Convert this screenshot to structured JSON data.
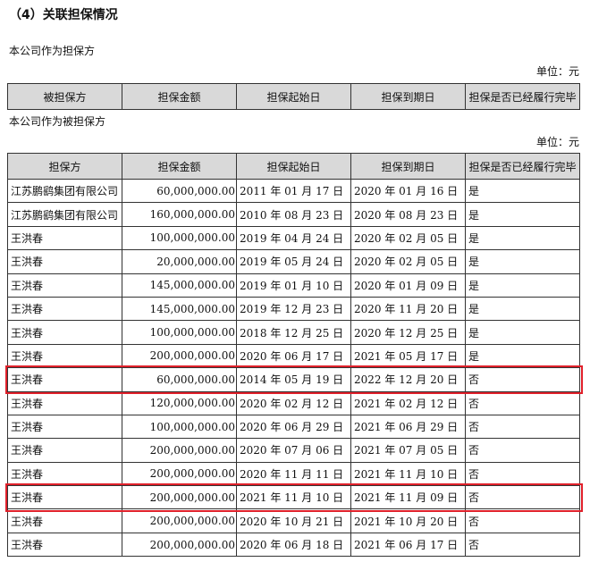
{
  "heading": "（4）关联担保情况",
  "section1": {
    "title": "本公司作为担保方",
    "unit": "单位：元",
    "headers": [
      "被担保方",
      "担保金额",
      "担保起始日",
      "担保到期日",
      "担保是否已经履行完毕"
    ]
  },
  "section2": {
    "title": "本公司作为被担保方",
    "unit": "单位：元",
    "headers": [
      "担保方",
      "担保金额",
      "担保起始日",
      "担保到期日",
      "担保是否已经履行完毕"
    ],
    "rows": [
      [
        "江苏鹏鹞集团有限公司",
        "60,000,000.00",
        "2011 年 01 月 17 日",
        "2020 年 01 月 16 日",
        "是"
      ],
      [
        "江苏鹏鹞集团有限公司",
        "160,000,000.00",
        "2010 年 08 月 23 日",
        "2020 年 08 月 23 日",
        "是"
      ],
      [
        "王洪春",
        "100,000,000.00",
        "2019 年 04 月 24 日",
        "2020 年 02 月 05 日",
        "是"
      ],
      [
        "王洪春",
        "20,000,000.00",
        "2019 年 05 月 24 日",
        "2020 年 02 月 05 日",
        "是"
      ],
      [
        "王洪春",
        "145,000,000.00",
        "2019 年 01 月 10 日",
        "2020 年 01 月 09 日",
        "是"
      ],
      [
        "王洪春",
        "145,000,000.00",
        "2019 年 12 月 23 日",
        "2020 年 11 月 20 日",
        "是"
      ],
      [
        "王洪春",
        "100,000,000.00",
        "2018 年 12 月 25 日",
        "2020 年 12 月 25 日",
        "是"
      ],
      [
        "王洪春",
        "200,000,000.00",
        "2020 年 06 月 17 日",
        "2021 年 05 月 17 日",
        "是"
      ],
      [
        "王洪春",
        "60,000,000.00",
        "2014 年 05 月 19 日",
        "2022 年 12 月 20 日",
        "否"
      ],
      [
        "王洪春",
        "120,000,000.00",
        "2020 年 02 月 12 日",
        "2021 年 02 月 12 日",
        "否"
      ],
      [
        "王洪春",
        "100,000,000.00",
        "2020 年 06 月 29 日",
        "2021 年 06 月 29 日",
        "否"
      ],
      [
        "王洪春",
        "200,000,000.00",
        "2020 年 07 月 06 日",
        "2021 年 07 月 05 日",
        "否"
      ],
      [
        "王洪春",
        "200,000,000.00",
        "2020 年 11 月 11 日",
        "2021 年 11 月 10 日",
        "否"
      ],
      [
        "王洪春",
        "200,000,000.00",
        "2021 年 11 月 10 日",
        "2021 年 11 月 09 日",
        "否"
      ],
      [
        "王洪春",
        "200,000,000.00",
        "2020 年 10 月 21 日",
        "2021 年 10 月 20 日",
        "否"
      ],
      [
        "王洪春",
        "200,000,000.00",
        "2020 年 06 月 18 日",
        "2021 年 06 月 17 日",
        "否"
      ]
    ]
  },
  "highlight_color": "#e0202a",
  "highlighted_rows": [
    8,
    13
  ]
}
